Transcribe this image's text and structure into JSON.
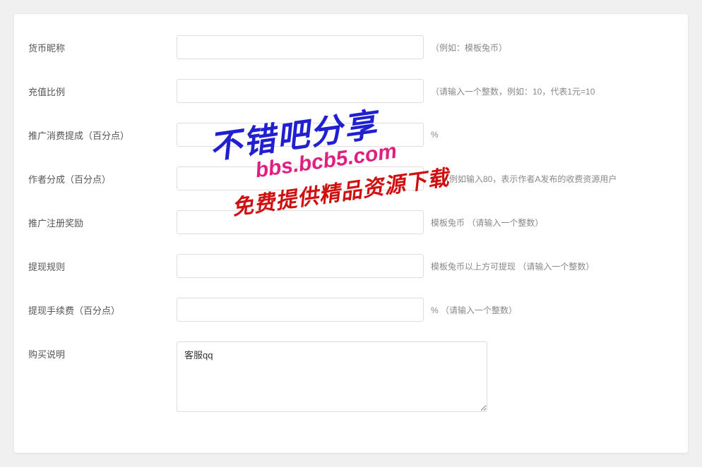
{
  "form": {
    "rows": [
      {
        "label": "货币昵称",
        "value": "",
        "hint": "（例如：模板兔币）",
        "type": "text"
      },
      {
        "label": "充值比例",
        "value": "",
        "hint": "（请输入一个整数，例如：10，代表1元=10",
        "type": "text"
      },
      {
        "label": "推广消费提成（百分点）",
        "value": "",
        "hint": "%",
        "type": "text"
      },
      {
        "label": "作者分成（百分点）",
        "value": "",
        "hint": "% （例如输入80，表示作者A发布的收费资源用户",
        "type": "text"
      },
      {
        "label": "推广注册奖励",
        "value": "",
        "hint": "模板兔币 （请输入一个整数）",
        "type": "text"
      },
      {
        "label": "提现规则",
        "value": "",
        "hint": "模板兔币以上方可提现 （请输入一个整数）",
        "type": "text"
      },
      {
        "label": "提现手续费（百分点）",
        "value": "",
        "hint": "% （请输入一个整数）",
        "type": "text"
      },
      {
        "label": "购买说明",
        "value": "客服qq",
        "hint": "",
        "type": "textarea"
      }
    ]
  },
  "watermark": {
    "line1": "不错吧分享",
    "line2": "bbs.bcb5.com",
    "line3": "免费提供精品资源下载"
  }
}
